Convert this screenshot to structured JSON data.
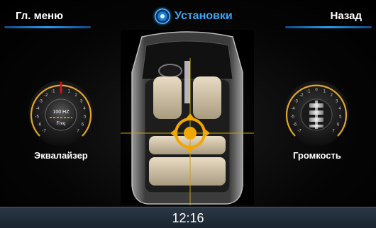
{
  "header": {
    "menu_label": "Гл. меню",
    "title": "Установки",
    "back_label": "Назад"
  },
  "equalizer": {
    "label": "Эквалайзер",
    "center_value": "100 HZ",
    "center_sub": "Freq",
    "scale": [
      "-7",
      "-6",
      "-5",
      "-4",
      "-3",
      "-2",
      "-1",
      "0",
      "1",
      "2",
      "3",
      "4",
      "5",
      "6",
      "7"
    ]
  },
  "volume": {
    "label": "Громкость",
    "scale": [
      "-7",
      "-6",
      "-5",
      "-4",
      "-3",
      "-2",
      "-1",
      "0",
      "1",
      "2",
      "3",
      "4",
      "5",
      "6",
      "7"
    ]
  },
  "status": {
    "time": "12:16"
  },
  "colors": {
    "accent": "#2f9be8",
    "knob_ring": "#e0a52a",
    "balance": "#f0a800"
  }
}
